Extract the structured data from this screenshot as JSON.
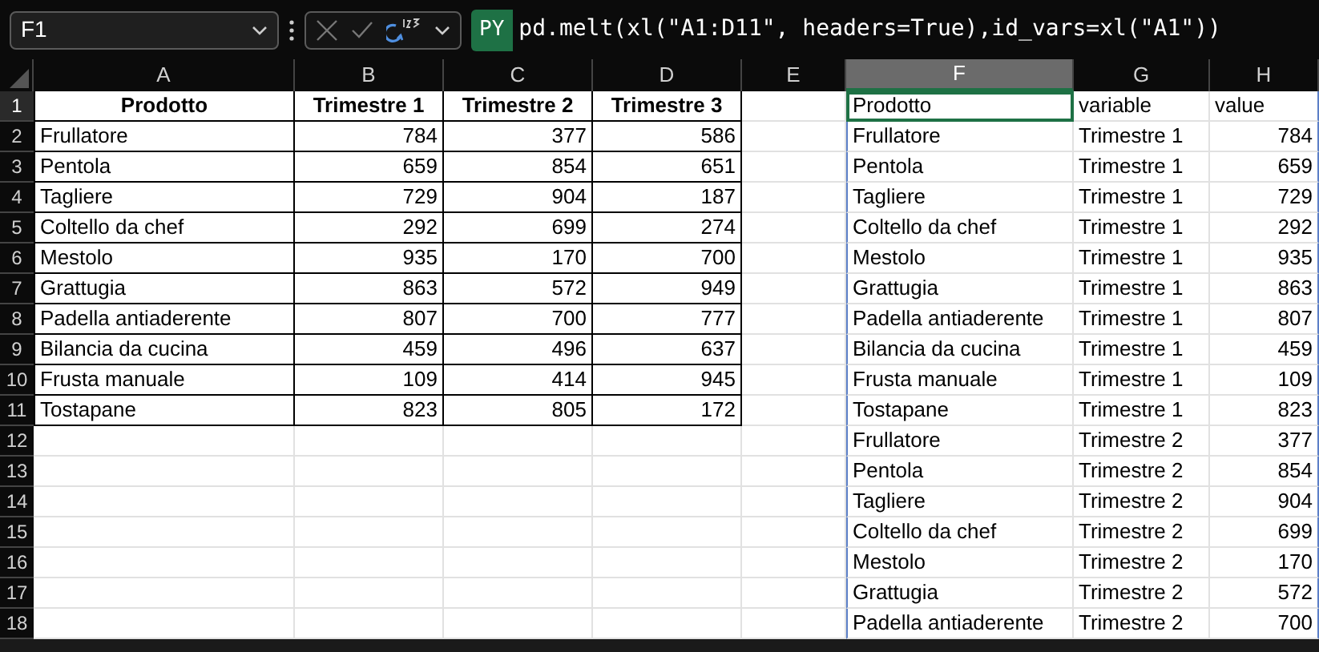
{
  "name_box": {
    "value": "F1"
  },
  "formula_bar": {
    "badge": "PY",
    "formula": "pd.melt(xl(\"A1:D11\", headers=True),id_vars=xl(\"A1\"))"
  },
  "columns": [
    {
      "label": "A",
      "selected": false
    },
    {
      "label": "B",
      "selected": false
    },
    {
      "label": "C",
      "selected": false
    },
    {
      "label": "D",
      "selected": false
    },
    {
      "label": "E",
      "selected": false
    },
    {
      "label": "F",
      "selected": true
    },
    {
      "label": "G",
      "selected": false
    },
    {
      "label": "H",
      "selected": false
    }
  ],
  "rows": [
    {
      "number": "1",
      "cells": {
        "A": "Prodotto",
        "B": "Trimestre 1",
        "C": "Trimestre 2",
        "D": "Trimestre 3",
        "F": "Prodotto",
        "G": "variable",
        "H": "value"
      }
    },
    {
      "number": "2",
      "cells": {
        "A": "Frullatore",
        "B": "784",
        "C": "377",
        "D": "586",
        "F": "Frullatore",
        "G": "Trimestre 1",
        "H": "784"
      }
    },
    {
      "number": "3",
      "cells": {
        "A": "Pentola",
        "B": "659",
        "C": "854",
        "D": "651",
        "F": "Pentola",
        "G": "Trimestre 1",
        "H": "659"
      }
    },
    {
      "number": "4",
      "cells": {
        "A": "Tagliere",
        "B": "729",
        "C": "904",
        "D": "187",
        "F": "Tagliere",
        "G": "Trimestre 1",
        "H": "729"
      }
    },
    {
      "number": "5",
      "cells": {
        "A": "Coltello da chef",
        "B": "292",
        "C": "699",
        "D": "274",
        "F": "Coltello da chef",
        "G": "Trimestre 1",
        "H": "292"
      }
    },
    {
      "number": "6",
      "cells": {
        "A": "Mestolo",
        "B": "935",
        "C": "170",
        "D": "700",
        "F": "Mestolo",
        "G": "Trimestre 1",
        "H": "935"
      }
    },
    {
      "number": "7",
      "cells": {
        "A": "Grattugia",
        "B": "863",
        "C": "572",
        "D": "949",
        "F": "Grattugia",
        "G": "Trimestre 1",
        "H": "863"
      }
    },
    {
      "number": "8",
      "cells": {
        "A": "Padella antiaderente",
        "B": "807",
        "C": "700",
        "D": "777",
        "F": "Padella antiaderente",
        "G": "Trimestre 1",
        "H": "807"
      }
    },
    {
      "number": "9",
      "cells": {
        "A": "Bilancia da cucina",
        "B": "459",
        "C": "496",
        "D": "637",
        "F": "Bilancia da cucina",
        "G": "Trimestre 1",
        "H": "459"
      }
    },
    {
      "number": "10",
      "cells": {
        "A": "Frusta manuale",
        "B": "109",
        "C": "414",
        "D": "945",
        "F": "Frusta manuale",
        "G": "Trimestre 1",
        "H": "109"
      }
    },
    {
      "number": "11",
      "cells": {
        "A": "Tostapane",
        "B": "823",
        "C": "805",
        "D": "172",
        "F": "Tostapane",
        "G": "Trimestre 1",
        "H": "823"
      }
    },
    {
      "number": "12",
      "cells": {
        "F": "Frullatore",
        "G": "Trimestre 2",
        "H": "377"
      }
    },
    {
      "number": "13",
      "cells": {
        "F": "Pentola",
        "G": "Trimestre 2",
        "H": "854"
      }
    },
    {
      "number": "14",
      "cells": {
        "F": "Tagliere",
        "G": "Trimestre 2",
        "H": "904"
      }
    },
    {
      "number": "15",
      "cells": {
        "F": "Coltello da chef",
        "G": "Trimestre 2",
        "H": "699"
      }
    },
    {
      "number": "16",
      "cells": {
        "F": "Mestolo",
        "G": "Trimestre 2",
        "H": "170"
      }
    },
    {
      "number": "17",
      "cells": {
        "F": "Grattugia",
        "G": "Trimestre 2",
        "H": "572"
      }
    },
    {
      "number": "18",
      "cells": {
        "F": "Padella antiaderente",
        "G": "Trimestre 2",
        "H": "700"
      }
    }
  ]
}
